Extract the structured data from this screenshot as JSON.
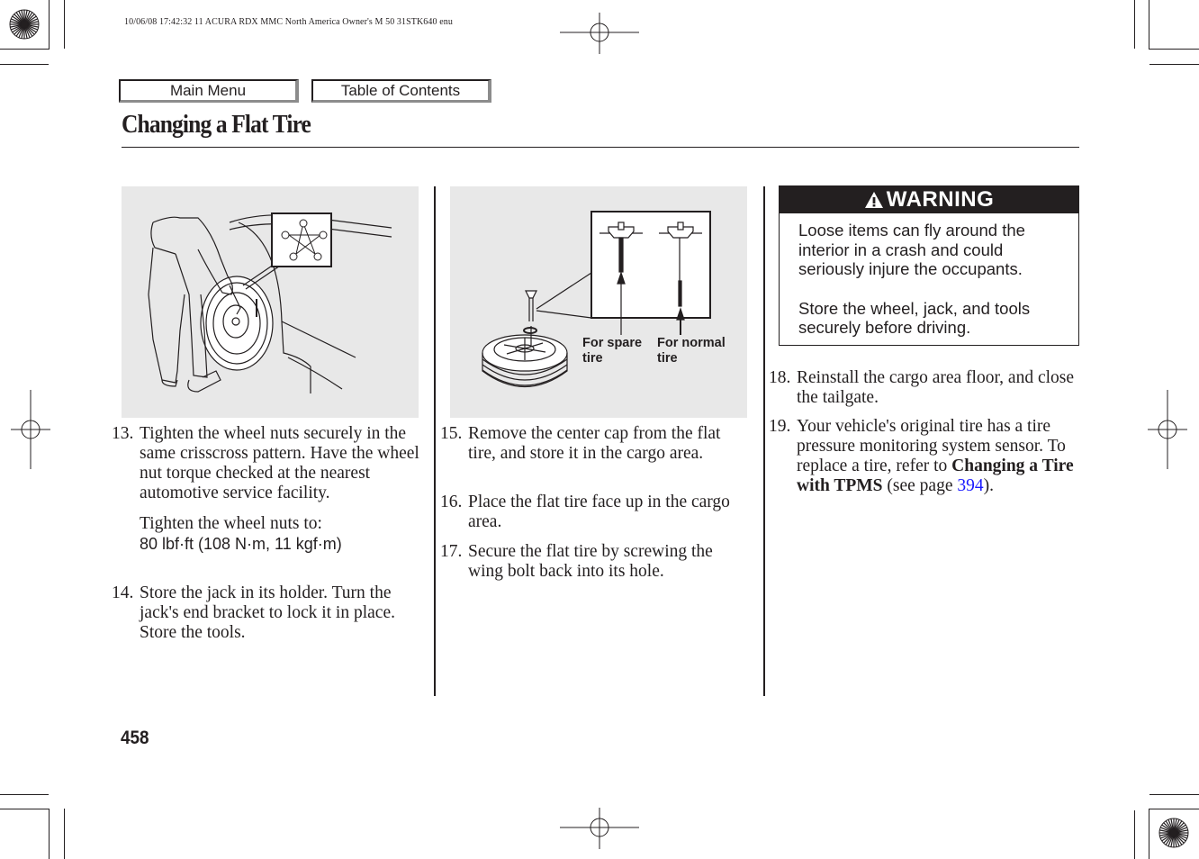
{
  "print_header": "10/06/08 17:42:32    11 ACURA RDX MMC North America Owner's M 50 31STK640 enu",
  "nav": {
    "main_menu_label": "Main Menu",
    "toc_label": "Table of Contents"
  },
  "page_title": "Changing a Flat Tire",
  "figures": {
    "figure1": {
      "icon": "wheel-nut-tightening-illustration",
      "inset": "crisscross-star-pattern-icon"
    },
    "figure2": {
      "icon": "spare-tire-wing-bolt-illustration",
      "label_spare": [
        "For spare",
        "tire"
      ],
      "label_normal": [
        "For normal",
        "tire"
      ]
    }
  },
  "steps": [
    {
      "number": "13.",
      "text": "Tighten the wheel nuts securely in the same crisscross pattern. Have the wheel nut torque checked at the nearest automotive service facility.",
      "sub_text": "Tighten the wheel nuts to:",
      "spec": "80 lbf·ft (108 N·m, 11 kgf·m)"
    },
    {
      "number": "14.",
      "text": "Store the jack in its holder. Turn the jack's end bracket to lock it in place. Store the tools."
    },
    {
      "number": "15.",
      "text": "Remove the center cap from the flat tire, and store it in the cargo area."
    },
    {
      "number": "16.",
      "text": "Place the flat tire face up in the cargo area."
    },
    {
      "number": "17.",
      "text": "Secure the flat tire by screwing the wing bolt back into its hole."
    },
    {
      "number": "18.",
      "text": "Reinstall the cargo area floor, and close the tailgate."
    },
    {
      "number": "19.",
      "text_before": "Your vehicle's original tire has a tire pressure monitoring system sensor. To replace a tire, refer to ",
      "bold_ref": "Changing a Tire with TPMS",
      "text_mid": " (see page ",
      "page_link": "394",
      "text_after": ")."
    }
  ],
  "warning": {
    "icon": "warning-triangle-icon",
    "title": "WARNING",
    "paragraphs": [
      "Loose items can fly around the interior in a crash and could seriously injure the occupants.",
      "Store the wheel, jack, and tools securely before driving."
    ]
  },
  "page_number": "458",
  "colors": {
    "ink": "#231f20",
    "figure_bg": "#e8e8e8",
    "link": "#1a1aff",
    "button_shadow": "#8c8c8c"
  }
}
